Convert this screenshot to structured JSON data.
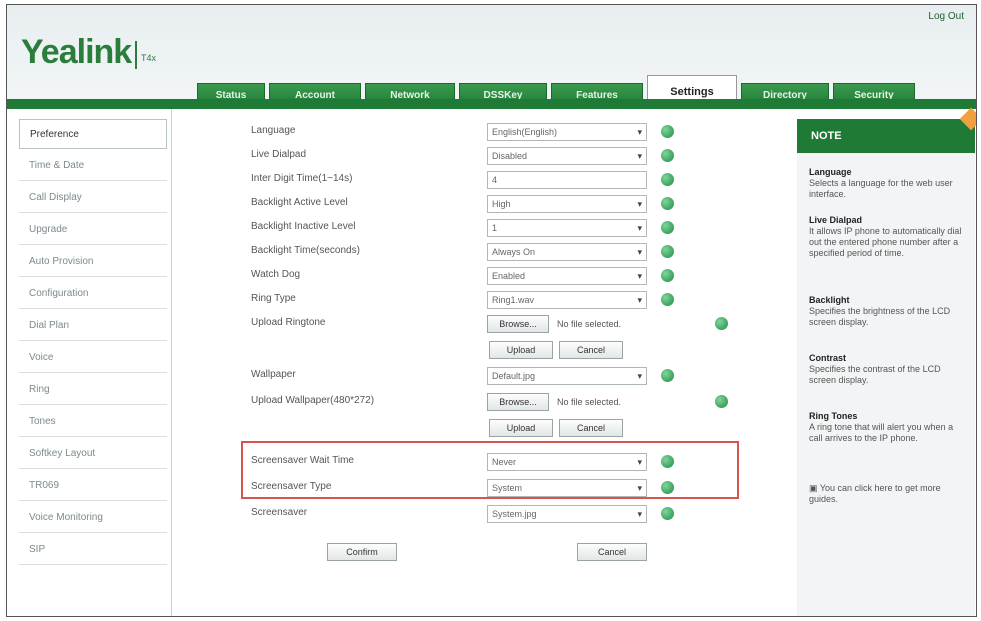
{
  "header": {
    "brand": "Yealink",
    "brand_tag": "T4x",
    "logout": "Log Out"
  },
  "tabs": [
    {
      "label": "Status"
    },
    {
      "label": "Account"
    },
    {
      "label": "Network"
    },
    {
      "label": "DSSKey"
    },
    {
      "label": "Features"
    },
    {
      "label": "Settings",
      "active": true
    },
    {
      "label": "Directory"
    },
    {
      "label": "Security"
    }
  ],
  "sidebar": {
    "items": [
      {
        "label": "Preference"
      },
      {
        "label": "Time & Date"
      },
      {
        "label": "Call Display"
      },
      {
        "label": "Upgrade"
      },
      {
        "label": "Auto Provision"
      },
      {
        "label": "Configuration"
      },
      {
        "label": "Dial Plan"
      },
      {
        "label": "Voice"
      },
      {
        "label": "Ring"
      },
      {
        "label": "Tones"
      },
      {
        "label": "Softkey Layout"
      },
      {
        "label": "TR069"
      },
      {
        "label": "Voice Monitoring"
      },
      {
        "label": "SIP"
      }
    ]
  },
  "form": {
    "language": {
      "label": "Language",
      "value": "English(English)"
    },
    "live_dialpad": {
      "label": "Live Dialpad",
      "value": "Disabled"
    },
    "inter_digit_time": {
      "label": "Inter Digit Time(1~14s)",
      "value": "4"
    },
    "backlight_active_level": {
      "label": "Backlight Active Level",
      "value": "High"
    },
    "backlight_inactive_level": {
      "label": "Backlight Inactive Level",
      "value": "1"
    },
    "backlight_time": {
      "label": "Backlight Time(seconds)",
      "value": "Always On"
    },
    "watch_dog": {
      "label": "Watch Dog",
      "value": "Enabled"
    },
    "ring_type": {
      "label": "Ring Type",
      "value": "Ring1.wav"
    },
    "upload_ringtone": {
      "label": "Upload Ringtone",
      "browse": "Browse...",
      "file": "No file selected.",
      "upload": "Upload",
      "cancel": "Cancel"
    },
    "wallpaper": {
      "label": "Wallpaper",
      "value": "Default.jpg"
    },
    "upload_wallpaper": {
      "label": "Upload Wallpaper(480*272)",
      "browse": "Browse...",
      "file": "No file selected.",
      "upload": "Upload",
      "cancel": "Cancel"
    },
    "screensaver_wait_time": {
      "label": "Screensaver Wait Time",
      "value": "Never"
    },
    "screensaver_type": {
      "label": "Screensaver Type",
      "value": "System"
    },
    "screensaver": {
      "label": "Screensaver",
      "value": "System.jpg"
    },
    "confirm": "Confirm",
    "cancel": "Cancel"
  },
  "note": {
    "title": "NOTE",
    "sections": [
      {
        "title": "Language",
        "text": "Selects a language for the web user interface."
      },
      {
        "title": "Live Dialpad",
        "text": "It allows IP phone to automatically dial out the entered phone number after a specified period of time."
      },
      {
        "title": "Backlight",
        "text": "Specifies the brightness of the LCD screen display."
      },
      {
        "title": "Contrast",
        "text": "Specifies the contrast of the LCD screen display."
      },
      {
        "title": "Ring Tones",
        "text": "A ring tone that will alert you when a call arrives to the IP phone."
      }
    ],
    "footer": "You can click here to get more guides."
  },
  "colors": {
    "brand_green": "#1f7a36",
    "highlight": "#d9534f"
  }
}
